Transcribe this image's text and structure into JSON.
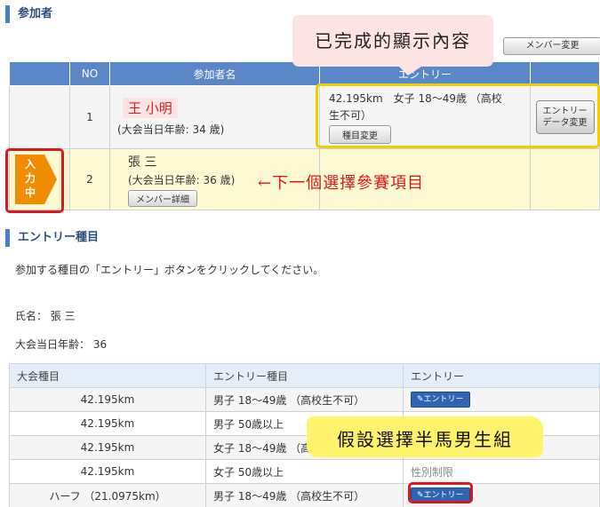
{
  "participants_section": {
    "title": "参加者",
    "change_members_label": "メンバー変更"
  },
  "participants_table": {
    "headers": [
      "NO",
      "参加者名",
      "エントリー"
    ],
    "rows": [
      {
        "no": "1",
        "name": "王 小明",
        "age_label": "(大会当日年齢: 34 歳)",
        "entry_line1": "42.195km　女子 18～49歳 （高校",
        "entry_line2": "生不可）",
        "event_change_label": "種目変更",
        "entry_data_change_line1": "エントリー",
        "entry_data_change_line2": "データ変更"
      },
      {
        "no": "2",
        "name": "張 三",
        "age_label": "(大会当日年齢: 36 歳)",
        "member_detail_label": "メンバー詳細",
        "input_badge_line1": "入",
        "input_badge_line2": "力",
        "input_badge_line3": "中"
      }
    ]
  },
  "annotations": {
    "completed_caption": "已完成的顯示內容",
    "next_caption": "←下一個選擇參賽項目",
    "assume_caption": "假設選擇半馬男生組"
  },
  "entry_section": {
    "title": "エントリー種目",
    "instruction": "参加する種目の「エントリー」ボタンをクリックしてください。",
    "name_label": "氏名： 張 三",
    "age_label": "大会当日年齢： 36"
  },
  "entry_table": {
    "headers": [
      "大会種目",
      "エントリー種目",
      "エントリー"
    ],
    "rows": [
      {
        "event": "42.195km",
        "category": "男子 18～49歳 （高校生不可）",
        "entry": "エントリー"
      },
      {
        "event": "42.195km",
        "category": "男子 50歳以上",
        "entry": ""
      },
      {
        "event": "42.195km",
        "category": "女子 18～49歳 （高校生不可）",
        "entry": ""
      },
      {
        "event": "42.195km",
        "category": "女子 50歳以上",
        "entry": "性別制限"
      },
      {
        "event": "ハーフ （21.0975km）",
        "category": "男子 18～49歳 （高校生不可）",
        "entry": "エントリー"
      }
    ]
  },
  "colors": {
    "header_blue": "#5a87c8",
    "highlight_yellow": "#fdf9d2",
    "badge_orange": "#f08c00",
    "annotation_red": "#d71920",
    "annotation_yellow": "#fff36b",
    "caption_pink": "#fde3e3"
  }
}
